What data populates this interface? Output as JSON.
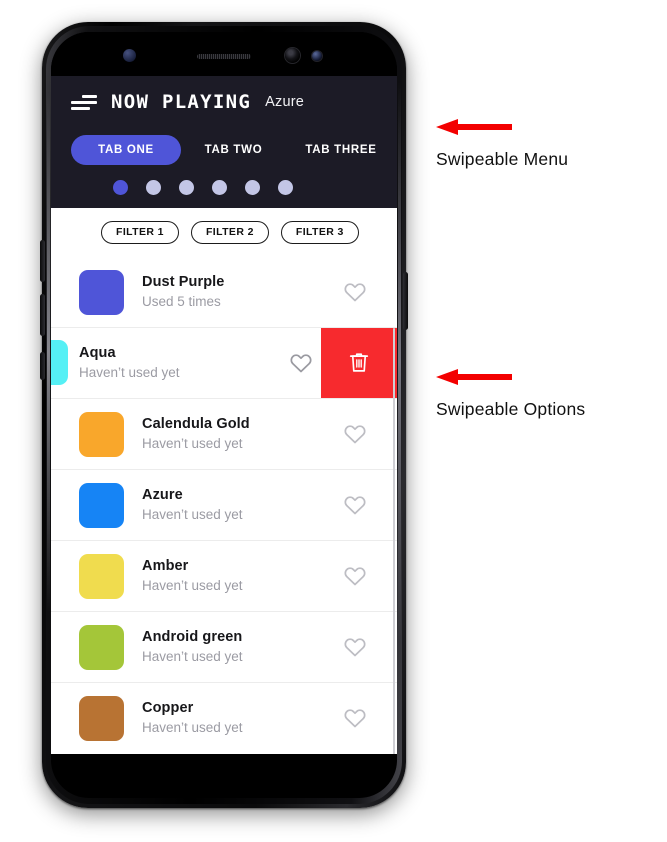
{
  "app": {
    "menu_icon": "hamburger-menu-icon",
    "title": "NOW PLAYING",
    "subtitle": "Azure"
  },
  "tabs": [
    {
      "label": "TAB ONE",
      "active": true
    },
    {
      "label": "TAB TWO",
      "active": false
    },
    {
      "label": "TAB THREE",
      "active": false
    }
  ],
  "pager": {
    "count": 6,
    "active_index": 0,
    "active_color": "#4f55d8",
    "inactive_color": "#c3c6e6"
  },
  "filters": [
    {
      "label": "FILTER 1"
    },
    {
      "label": "FILTER 2"
    },
    {
      "label": "FILTER 3"
    }
  ],
  "list": {
    "items": [
      {
        "name": "Dust Purple",
        "usage": "Used 5 times",
        "color": "#4f55d8",
        "favorite_icon": "heart-outline-icon",
        "swiped": false
      },
      {
        "name": "Aqua",
        "usage": "Haven’t used yet",
        "color": "#55f0f5",
        "favorite_icon": "heart-outline-icon",
        "swiped": true,
        "action_label": "Delete",
        "action_icon": "trash-icon",
        "action_color": "#f72a2e"
      },
      {
        "name": "Calendula Gold",
        "usage": "Haven’t used yet",
        "color": "#f9a72b",
        "favorite_icon": "heart-outline-icon",
        "swiped": false
      },
      {
        "name": "Azure",
        "usage": "Haven’t used yet",
        "color": "#1684f5",
        "favorite_icon": "heart-outline-icon",
        "swiped": false
      },
      {
        "name": "Amber",
        "usage": "Haven’t used yet",
        "color": "#f0dc4e",
        "favorite_icon": "heart-outline-icon",
        "swiped": false
      },
      {
        "name": "Android green",
        "usage": "Haven’t used yet",
        "color": "#a4c639",
        "favorite_icon": "heart-outline-icon",
        "swiped": false
      },
      {
        "name": "Copper",
        "usage": "Haven’t used yet",
        "color": "#b87333",
        "favorite_icon": "heart-outline-icon",
        "swiped": false
      }
    ]
  },
  "annotations": [
    {
      "label": "Swipeable Menu",
      "arrow_icon": "left-arrow-icon",
      "arrow_color": "#f30000"
    },
    {
      "label": "Swipeable Options",
      "arrow_icon": "left-arrow-icon",
      "arrow_color": "#f30000"
    }
  ],
  "device": {
    "sensor_icon": "proximity-sensor-icon",
    "speaker_icon": "earpiece-speaker-icon",
    "camera_icon": "front-camera-icon",
    "iris_icon": "iris-scanner-icon"
  }
}
